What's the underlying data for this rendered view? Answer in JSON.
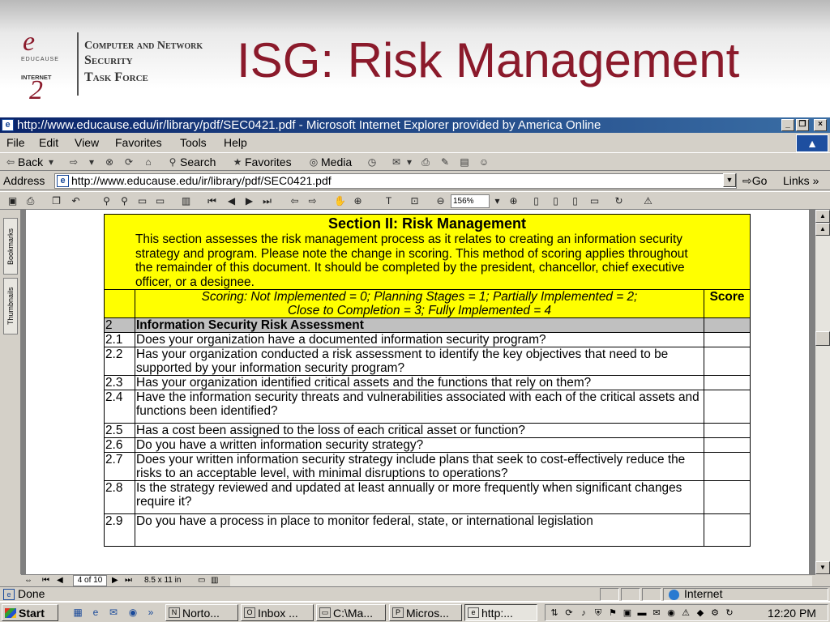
{
  "slide": {
    "logo_letter": "e",
    "logo_educause": "EDUCAUSE",
    "logo_internet": "INTERNET",
    "logo_number": "2",
    "taskforce_line1": "Computer and Network",
    "taskforce_line2": "Security",
    "taskforce_line3": "Task Force",
    "title": "ISG: Risk Management"
  },
  "window": {
    "title": "http://www.educause.edu/ir/library/pdf/SEC0421.pdf - Microsoft Internet Explorer provided by America Online"
  },
  "menu": [
    "File",
    "Edit",
    "View",
    "Favorites",
    "Tools",
    "Help"
  ],
  "toolbar": {
    "back": "Back",
    "search": "Search",
    "favorites": "Favorites",
    "media": "Media"
  },
  "address": {
    "label": "Address",
    "url": "http://www.educause.edu/ir/library/pdf/SEC0421.pdf",
    "go": "Go",
    "links": "Links"
  },
  "acrobat": {
    "zoom": "156%"
  },
  "nav_tabs": [
    "Bookmarks",
    "Thumbnails"
  ],
  "document": {
    "section_title": "Section II: Risk Management",
    "section_description": "This section assesses the risk management process as it relates to creating an information security strategy and program.  Please note the change in scoring. This method of scoring applies throughout the remainder of this document.  It should be completed by the president, chancellor, chief executive officer, or a designee.",
    "scoring_line1": "Scoring: Not Implemented = 0;   Planning Stages = 1;   Partially Implemented = 2;",
    "scoring_line2": "Close to Completion = 3;   Fully Implemented = 4",
    "score_header": "Score",
    "heading_number": "2",
    "heading_text": "Information Security Risk Assessment",
    "rows": [
      {
        "num": "2.1",
        "text": "Does your organization have a documented information security program?"
      },
      {
        "num": "2.2",
        "text": "Has your organization conducted a risk assessment to identify the key objectives that need to be supported by your information security program?"
      },
      {
        "num": "2.3",
        "text": "Has your organization identified critical assets and the functions that rely on them?"
      },
      {
        "num": "2.4",
        "text": "Have the information security threats and vulnerabilities associated with each of the critical assets and functions been identified?"
      },
      {
        "num": "2.5",
        "text": "Has a cost been assigned to the loss of each critical asset or function?"
      },
      {
        "num": "2.6",
        "text": "Do you have a written information security strategy?"
      },
      {
        "num": "2.7",
        "text": "Does your written information security strategy include plans that seek to cost-effectively reduce the risks to an acceptable level, with minimal disruptions to operations?"
      },
      {
        "num": "2.8",
        "text": "Is the strategy reviewed and updated at least annually or more frequently when significant changes require it?"
      },
      {
        "num": "2.9",
        "text": "Do you have a process in place to monitor federal, state, or international legislation"
      }
    ]
  },
  "pdf_status": {
    "page": "4 of 10",
    "page_size": "8.5 x 11 in"
  },
  "status": {
    "text": "Done",
    "zone": "Internet"
  },
  "taskbar": {
    "start": "Start",
    "tasks": [
      {
        "label": "Norto..."
      },
      {
        "label": "Inbox ..."
      },
      {
        "label": "C:\\Ma..."
      },
      {
        "label": "Micros..."
      },
      {
        "label": "http:..."
      }
    ],
    "clock": "12:20 PM"
  }
}
